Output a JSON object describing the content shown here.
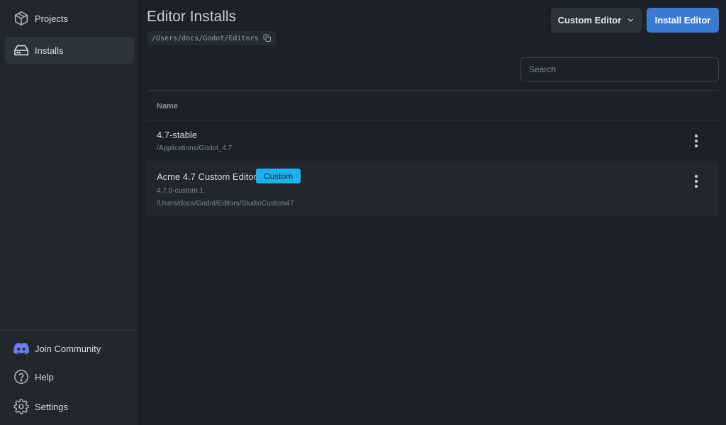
{
  "sidebar": {
    "items": [
      {
        "label": "Projects",
        "icon": "package-icon",
        "active": false
      },
      {
        "label": "Installs",
        "icon": "hard-drive-icon",
        "active": true
      }
    ],
    "footer": [
      {
        "label": "Join Community",
        "icon": "discord-icon"
      },
      {
        "label": "Help",
        "icon": "help-circle-icon"
      },
      {
        "label": "Settings",
        "icon": "gear-icon"
      }
    ]
  },
  "header": {
    "title": "Editor Installs",
    "path": "/Users/docs/Godot/Editors",
    "custom_editor_label": "Custom Editor",
    "install_editor_label": "Install Editor"
  },
  "search": {
    "placeholder": "Search",
    "value": ""
  },
  "table": {
    "column_name": "Name",
    "rows": [
      {
        "name": "4.7-stable",
        "path": "/Applications/Godot_4.7"
      },
      {
        "name": "Acme 4.7 Custom Editor",
        "badge": "Custom",
        "version": "4.7.0-custom.1",
        "path": "/Users/docs/Godot/Editors/StudioCustom47"
      }
    ]
  },
  "colors": {
    "background": "#1c2128",
    "sidebar": "#22272e",
    "accent": "#3b7bd1",
    "badge": "#1eb2ec",
    "discord": "#6b7ff0"
  }
}
